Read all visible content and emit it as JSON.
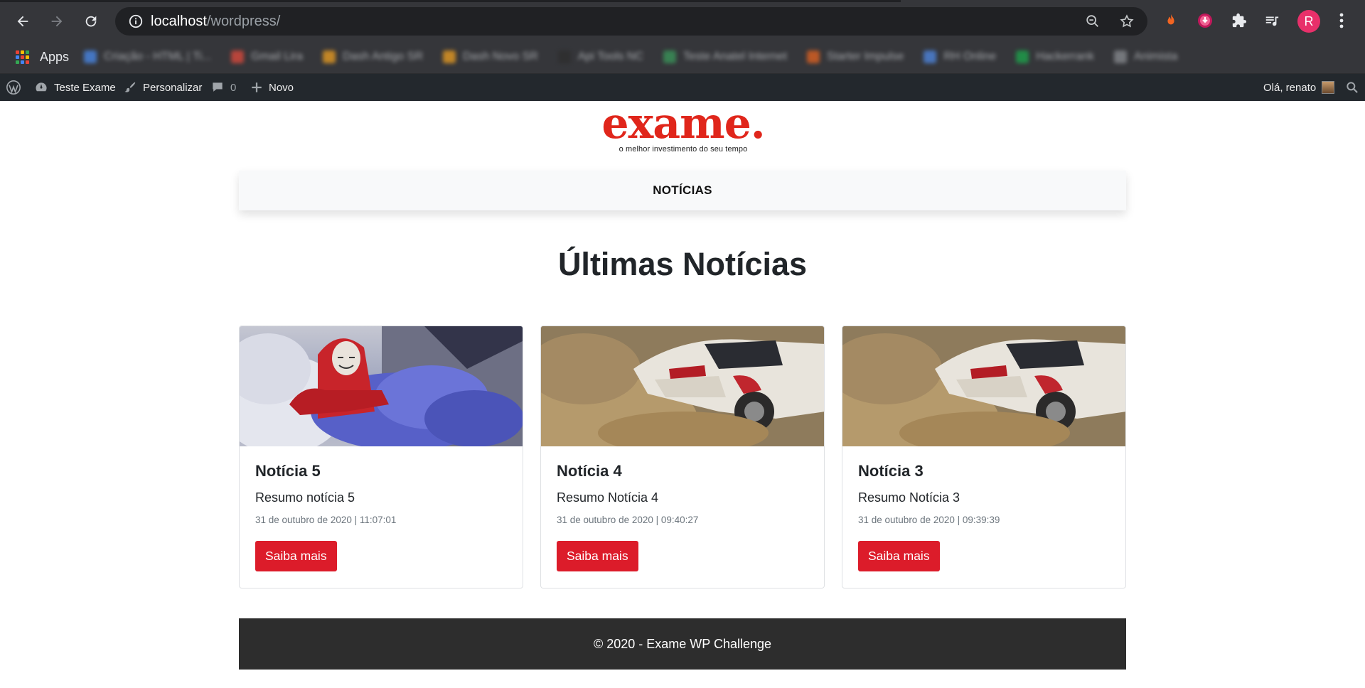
{
  "browser": {
    "url_host": "localhost",
    "url_path": "/wordpress/",
    "profile_initial": "R",
    "bookmarks_apps_label": "Apps",
    "bookmarks": [
      {
        "label": "Criação - HTML | Ti...",
        "color": "#4a8cf0"
      },
      {
        "label": "Gmail Lira",
        "color": "#e34a3c"
      },
      {
        "label": "Dash Antigo SR",
        "color": "#f0a020"
      },
      {
        "label": "Dash Novo SR",
        "color": "#f0a020"
      },
      {
        "label": "Api Tools NC",
        "color": "#2d2d2d"
      },
      {
        "label": "Teste Anatel Internet",
        "color": "#3a9a5b"
      },
      {
        "label": "Starter Impulse",
        "color": "#e8641f"
      },
      {
        "label": "RH Online",
        "color": "#4f8ae8"
      },
      {
        "label": "Hackerrank",
        "color": "#1ba94c"
      },
      {
        "label": "Animista",
        "color": "#8a8d92"
      }
    ]
  },
  "adminbar": {
    "site_name": "Teste Exame",
    "customize": "Personalizar",
    "comments_count": "0",
    "new_label": "Novo",
    "greeting": "Olá, renato"
  },
  "site": {
    "logo_word": "exame.",
    "logo_tagline": "o melhor investimento do seu tempo",
    "nav": [
      "NOTÍCIAS"
    ],
    "heading": "Últimas Notícias",
    "footer": "© 2020 - Exame WP Challenge",
    "brand_color": "#dc1c2a"
  },
  "posts": [
    {
      "title": "Notícia 5",
      "excerpt": "Resumo notícia 5",
      "date": "31 de outubro de 2020 | 11:07:01",
      "button": "Saiba mais",
      "image": "protester-smoke"
    },
    {
      "title": "Notícia 4",
      "excerpt": "Resumo Notícia 4",
      "date": "31 de outubro de 2020 | 09:40:27",
      "button": "Saiba mais",
      "image": "rally-car"
    },
    {
      "title": "Notícia 3",
      "excerpt": "Resumo Notícia 3",
      "date": "31 de outubro de 2020 | 09:39:39",
      "button": "Saiba mais",
      "image": "rally-car"
    }
  ]
}
